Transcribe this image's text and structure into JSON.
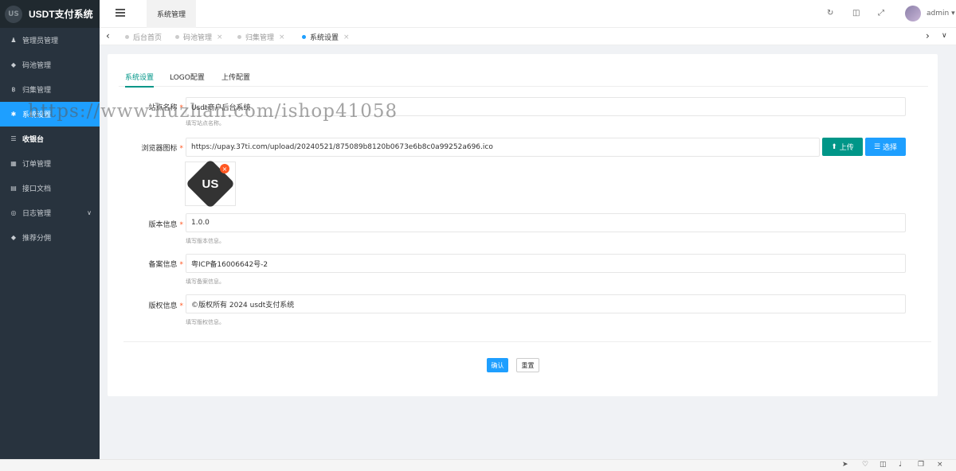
{
  "app": {
    "title": "USDT支付系统",
    "logo_mark": "US"
  },
  "sidebar": {
    "items": [
      {
        "label": "管理员管理",
        "icon": "user-icon"
      },
      {
        "label": "码池管理",
        "icon": "diamond-icon"
      },
      {
        "label": "归集管理",
        "icon": "bitcoin-icon"
      },
      {
        "label": "系统设置",
        "icon": "gear-icon"
      },
      {
        "label": "收银台",
        "icon": "list-icon"
      },
      {
        "label": "订单管理",
        "icon": "calculator-icon"
      },
      {
        "label": "接口文档",
        "icon": "doc-icon"
      },
      {
        "label": "日志管理",
        "icon": "log-icon"
      },
      {
        "label": "推荐分佣",
        "icon": "diamond-icon"
      }
    ]
  },
  "header": {
    "active_tab": "系统管理",
    "username": "admin"
  },
  "page_tabs": [
    {
      "label": "后台首页"
    },
    {
      "label": "码池管理"
    },
    {
      "label": "归集管理"
    },
    {
      "label": "系统设置"
    }
  ],
  "content_tabs": [
    "系统设置",
    "LOGO配置",
    "上传配置"
  ],
  "form": {
    "site_name": {
      "label": "站点名称",
      "value": "Usdt商户后台系统",
      "hint": "填写站点名称。"
    },
    "favicon": {
      "label": "浏览器图标",
      "value": "https://upay.37ti.com/upload/20240521/875089b8120b0673e6b8c0a99252a696.ico",
      "upload_label": "上传",
      "choose_label": "选择"
    },
    "version": {
      "label": "版本信息",
      "value": "1.0.0",
      "hint": "填写版本信息。"
    },
    "icp": {
      "label": "备案信息",
      "value": "粤ICP备16006642号-2",
      "hint": "填写备案信息。"
    },
    "copyright": {
      "label": "版权信息",
      "value": "©版权所有 2024 usdt支付系统",
      "hint": "填写版权信息。"
    },
    "required_mark": "*"
  },
  "actions": {
    "confirm": "确认",
    "reset": "重置"
  },
  "watermark": "https://www.huzhan.com/ishop41058",
  "colors": {
    "sidebar_bg": "#28333e",
    "active": "#1e9fff",
    "primary": "#009688",
    "danger": "#ff5722"
  }
}
